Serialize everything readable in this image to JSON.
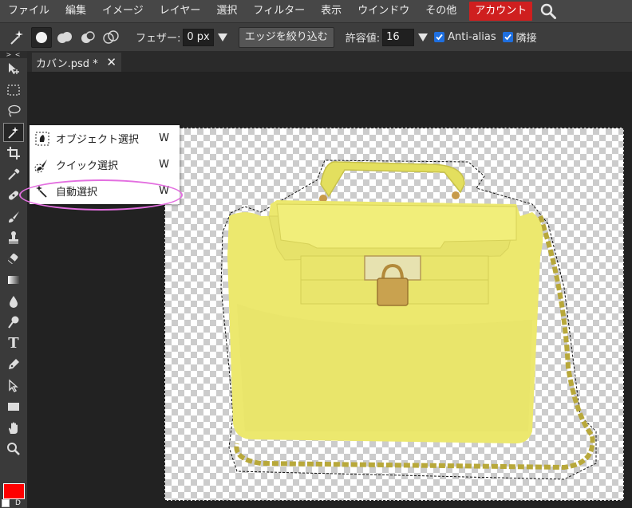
{
  "menubar": {
    "items": [
      "ファイル",
      "編集",
      "イメージ",
      "レイヤー",
      "選択",
      "フィルター",
      "表示",
      "ウインドウ",
      "その他"
    ],
    "account_label": "アカウント",
    "search_icon": "search-icon",
    "account_color": "#cf1f1f"
  },
  "options": {
    "tool_icon": "magic-wand-icon",
    "modes": [
      "new-selection-icon",
      "add-selection-icon",
      "subtract-selection-icon",
      "intersect-selection-icon"
    ],
    "feather_label": "フェザー:",
    "feather_value": "0 px",
    "refine_edge_label": "エッジを絞り込む",
    "tolerance_label": "許容値:",
    "tolerance_value": "16",
    "antialias_label": "Anti-alias",
    "antialias_checked": true,
    "contiguous_label": "隣接",
    "contiguous_checked": true
  },
  "toolbar": {
    "collapse_label": "> <",
    "tools": [
      "move-icon",
      "marquee-icon",
      "lasso-icon",
      "magic-wand-icon",
      "crop-icon",
      "eyedropper-icon",
      "healing-icon",
      "brush-icon",
      "stamp-icon",
      "eraser-icon",
      "gradient-icon",
      "blur-icon",
      "dodge-icon",
      "type-icon",
      "pen-icon",
      "path-select-icon",
      "shape-icon",
      "hand-icon",
      "zoom-icon"
    ],
    "type_tool_glyph": "T",
    "active_tool": "magic-wand-icon",
    "foreground_color": "#ff0000",
    "default_colors_label": "D"
  },
  "document": {
    "tab_label": "カバン.psd *",
    "close_glyph": "✕"
  },
  "flyout": {
    "items": [
      {
        "icon": "object-select-icon",
        "label": "オブジェクト選択",
        "key": "W"
      },
      {
        "icon": "quick-select-icon",
        "label": "クイック選択",
        "key": "W"
      },
      {
        "icon": "magic-wand-icon",
        "label": "自動選択",
        "key": "W"
      }
    ],
    "highlight_color": "#e36fe0"
  },
  "canvas": {
    "image_subject": "yellow-handbag-image",
    "bag_color": "#e8e46a"
  }
}
